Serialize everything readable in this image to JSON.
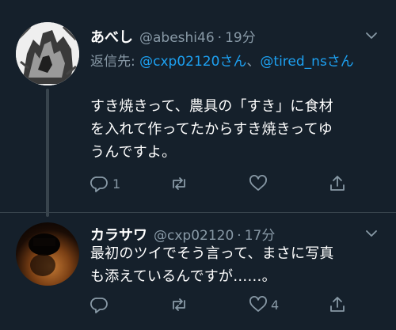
{
  "tweets": [
    {
      "name": "あべし",
      "handle": "@abeshi46",
      "separator": "·",
      "time": "19分",
      "reply_prefix": "返信先: ",
      "reply_to_1": "@cxp02120さん",
      "reply_joiner": "、",
      "reply_to_2": "@tired_nsさん",
      "text_line1": "すき焼きって、農具の「すき」に食材",
      "text_line2": "を入れて作ってたからすき焼きってゆ",
      "text_line3": "うんですよ。",
      "reply_count": "1",
      "retweet_count": "",
      "like_count": ""
    },
    {
      "name": "カラサワ",
      "handle": "@cxp02120",
      "separator": "·",
      "time": "17分",
      "text_line1": "最初のツイでそう言って、まさに写真",
      "text_line2": "も添えているんですが……。",
      "reply_count": "",
      "retweet_count": "",
      "like_count": "4"
    }
  ],
  "icons": {
    "menu": "chevron-down-icon",
    "reply": "reply-icon",
    "retweet": "retweet-icon",
    "like": "like-icon",
    "share": "share-icon"
  },
  "colors": {
    "background": "#15202b",
    "secondary_text": "#8899a6",
    "link": "#1da1f2",
    "divider": "#38444d"
  }
}
